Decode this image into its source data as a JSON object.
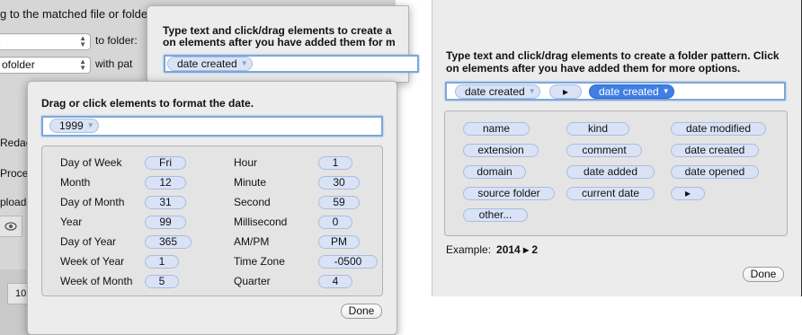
{
  "background_window": {
    "top_text": "g to the matched file or folder",
    "to_folder_label": "to folder:",
    "combo2_value": "ofolder",
    "with_label": "with pat",
    "side_labels": [
      "Redac",
      "Proces",
      "pload"
    ],
    "bottom_cell": "10"
  },
  "top_popover": {
    "title_line1": "Type text and click/drag elements to create a",
    "title_line2": "on elements after you have added them for m",
    "token": "date created"
  },
  "date_popover": {
    "title": "Drag or click elements to format the date.",
    "token": "1999",
    "rows_left": [
      {
        "label": "Day of Week",
        "value": "Fri"
      },
      {
        "label": "Month",
        "value": "12"
      },
      {
        "label": "Day of Month",
        "value": "31"
      },
      {
        "label": "Year",
        "value": "99"
      },
      {
        "label": "Day of Year",
        "value": "365"
      },
      {
        "label": "Week of Year",
        "value": "1"
      },
      {
        "label": "Week of Month",
        "value": "5"
      }
    ],
    "rows_right": [
      {
        "label": "Hour",
        "value": "1"
      },
      {
        "label": "Minute",
        "value": "30"
      },
      {
        "label": "Second",
        "value": "59"
      },
      {
        "label": "Millisecond",
        "value": "0"
      },
      {
        "label": "AM/PM",
        "value": "PM"
      },
      {
        "label": "Time Zone",
        "value": "-0500"
      },
      {
        "label": "Quarter",
        "value": "4"
      }
    ],
    "done_label": "Done"
  },
  "folder_popover": {
    "title_line1": "Type text and click/drag elements to create a folder pattern. Click",
    "title_line2": "on elements after you have added them for more options.",
    "tokens": [
      "date created",
      "▸",
      "date created"
    ],
    "elements": [
      [
        "name",
        "kind",
        "date modified"
      ],
      [
        "extension",
        "comment",
        "date created"
      ],
      [
        "domain",
        "date added",
        "date opened"
      ],
      [
        "source folder",
        "current date",
        "▸"
      ],
      [
        "other..."
      ]
    ],
    "example_label": "Example:",
    "example_value": "2014 ▸ 2",
    "done_label": "Done"
  },
  "icons": {
    "eye": "eye-icon",
    "caret": "chevron-down-icon",
    "separator": "triangle-right-icon"
  }
}
